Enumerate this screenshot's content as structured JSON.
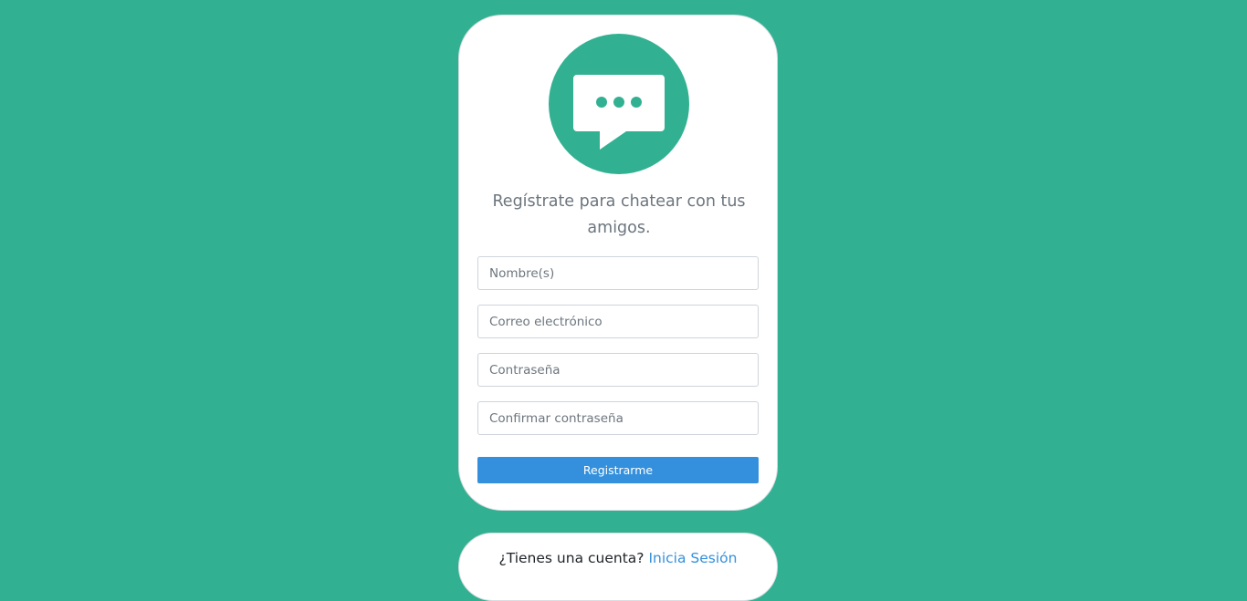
{
  "register": {
    "subtitle": "Regístrate para chatear con tus amigos.",
    "fields": {
      "name_placeholder": "Nombre(s)",
      "email_placeholder": "Correo electrónico",
      "password_placeholder": "Contraseña",
      "confirm_placeholder": "Confirmar contraseña"
    },
    "submit_label": "Registrarme"
  },
  "login_prompt": {
    "question": "¿Tienes una cuenta?",
    "link_label": "Inicia Sesión"
  },
  "icons": {
    "logo": "chat-bubble-icon"
  },
  "colors": {
    "background": "#32b192",
    "card": "#ffffff",
    "primary_button": "#3490dc",
    "link": "#3490dc",
    "muted_text": "#6c757d"
  }
}
